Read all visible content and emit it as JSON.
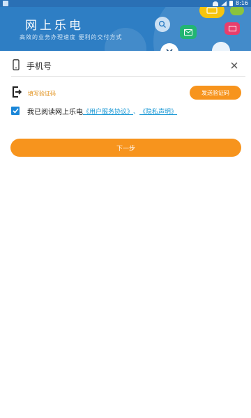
{
  "status_bar": {
    "time": "8:16",
    "bg_color": "#2a70b5"
  },
  "banner": {
    "title": "网上乐电",
    "slogan": "高效的业务办理速度  便利的交付方式",
    "bg_color": "#2e7ec4",
    "icons": [
      "wifi-icon",
      "search-icon",
      "mail-icon",
      "card-icon",
      "tools-icon",
      "chat-icon",
      "device-icon"
    ]
  },
  "phone": {
    "placeholder": "手机号",
    "icon": "mobile-phone-icon",
    "clear_icon": "close-icon"
  },
  "code": {
    "placeholder": "填写验证码",
    "icon": "exit-code-icon",
    "send_label": "发送验证码"
  },
  "agreement": {
    "checked": true,
    "text": "我已阅读网上乐电",
    "service_link": "《用户服务协议》",
    "separator": "、",
    "privacy_link": "《隐私声明》"
  },
  "next_button": {
    "label": "下一步"
  },
  "colors": {
    "accent": "#f7941d",
    "link": "#1d9ad6",
    "checkbox": "#1a86d8",
    "code_hint": "#e1901a"
  }
}
